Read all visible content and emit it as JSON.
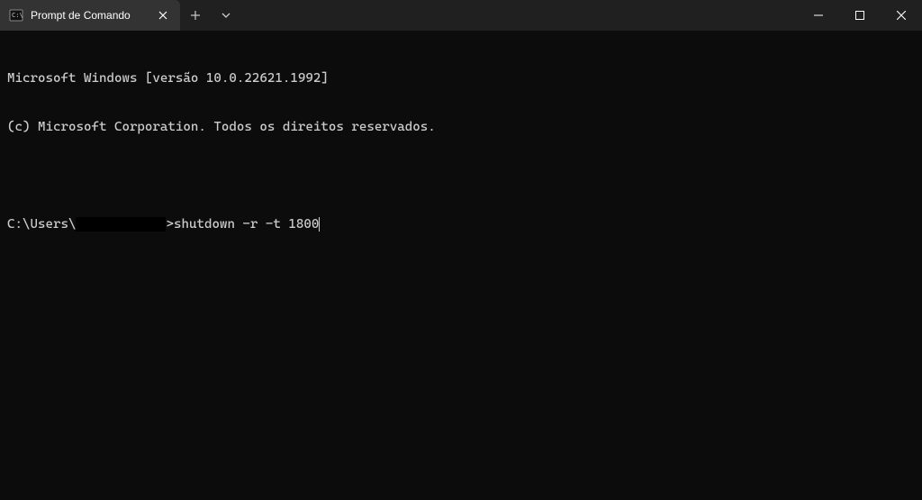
{
  "titlebar": {
    "tab_title": "Prompt de Comando"
  },
  "terminal": {
    "line1": "Microsoft Windows [versão 10.0.22621.1992]",
    "line2": "(c) Microsoft Corporation. Todos os direitos reservados.",
    "prompt_prefix": "C:\\Users\\",
    "prompt_suffix": ">",
    "command": "shutdown -r -t 1800"
  }
}
